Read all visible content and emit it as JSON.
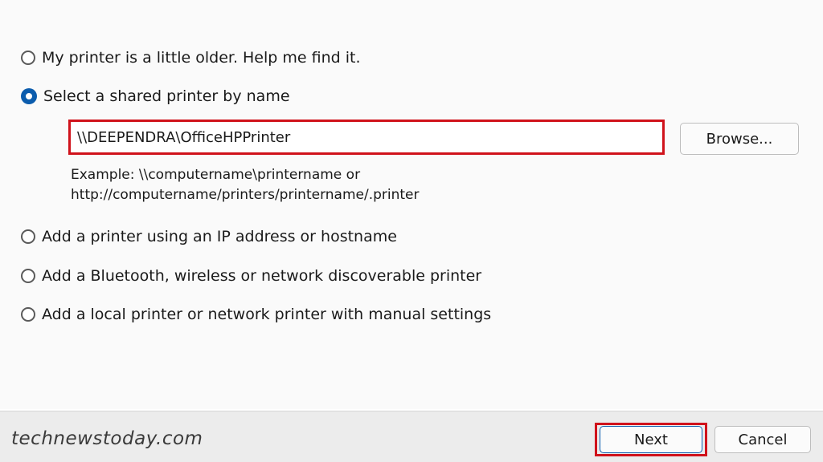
{
  "options": [
    {
      "label": "My printer is a little older. Help me find it.",
      "checked": false
    },
    {
      "label": "Select a shared printer by name",
      "checked": true
    },
    {
      "label": "Add a printer using an IP address or hostname",
      "checked": false
    },
    {
      "label": "Add a Bluetooth, wireless or network discoverable printer",
      "checked": false
    },
    {
      "label": "Add a local printer or network printer with manual settings",
      "checked": false
    }
  ],
  "shared_printer": {
    "value": "\\\\DEEPENDRA\\OfficeHPPrinter",
    "browse_label": "Browse...",
    "example_line1": "Example: \\\\computername\\printername or",
    "example_line2": "http://computername/printers/printername/.printer"
  },
  "footer": {
    "watermark": "technewstoday.com",
    "next_label": "Next",
    "cancel_label": "Cancel"
  },
  "colors": {
    "highlight": "#d0121b",
    "accent": "#0b5cad"
  }
}
